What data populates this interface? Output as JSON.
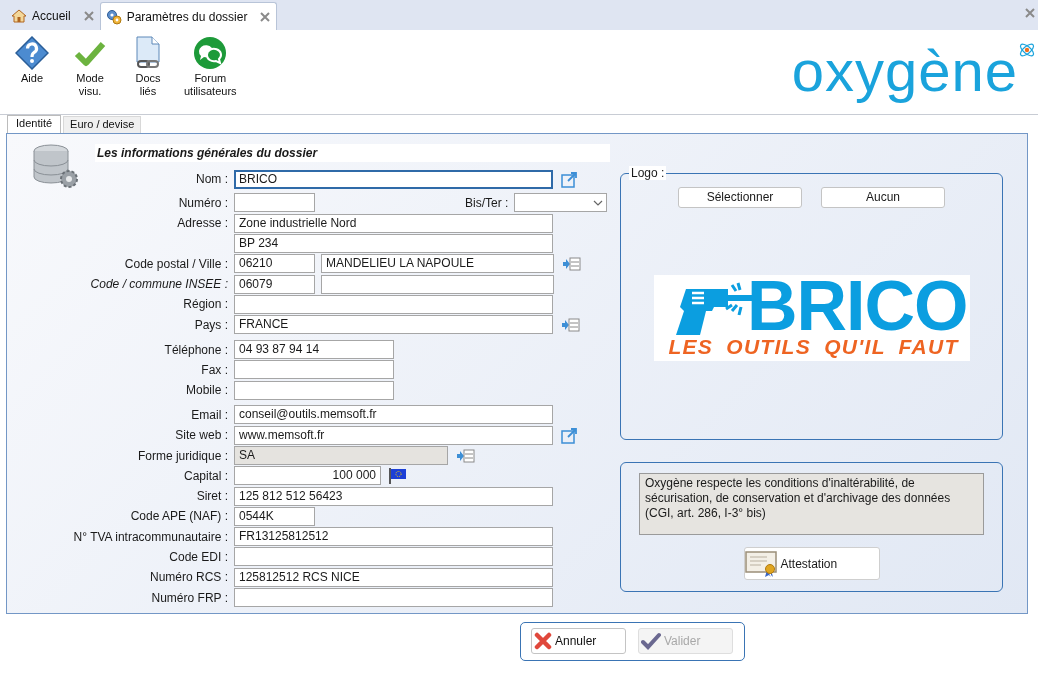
{
  "tabs": [
    {
      "label": "Accueil",
      "selected": false
    },
    {
      "label": "Paramètres du dossier",
      "selected": true
    }
  ],
  "toolbar": [
    {
      "lines": [
        "Aide"
      ]
    },
    {
      "lines": [
        "Mode",
        "visu."
      ]
    },
    {
      "lines": [
        "Docs",
        "liés"
      ]
    },
    {
      "lines": [
        "Forum",
        "utilisateurs"
      ]
    }
  ],
  "brand": {
    "name": "oxygène"
  },
  "subtabs": [
    {
      "label": "Identité",
      "selected": true
    },
    {
      "label": "Euro / devise",
      "selected": false
    }
  ],
  "section_title": "Les informations générales du dossier",
  "form_groups": [
    {
      "rows": [
        {
          "label": "Nom :",
          "italic": false,
          "kind": "link",
          "fields": [
            {
              "kind": "long",
              "value": "BRICO",
              "focused": true,
              "disabled": false
            }
          ]
        },
        {
          "label": "Numéro :",
          "italic": false,
          "fields": [
            {
              "kind": "short",
              "focused": false,
              "disabled": false
            },
            {
              "kind": "select",
              "label": "Bis/Ter :",
              "focused": false,
              "disabled": false
            }
          ]
        },
        {
          "label": "Adresse :",
          "italic": false,
          "fields": [
            {
              "kind": "long",
              "value": "Zone industrielle Nord",
              "focused": false,
              "disabled": false
            }
          ]
        },
        {
          "fields": [
            {
              "kind": "long",
              "value": "BP 234",
              "focused": false,
              "disabled": false
            }
          ]
        },
        {
          "label": "Code postal / Ville :",
          "italic": false,
          "kind": "list",
          "fields": [
            {
              "kind": "short",
              "value": "06210",
              "focused": false,
              "disabled": false
            },
            {
              "kind": "city",
              "value": "MANDELIEU LA NAPOULE",
              "focused": false,
              "disabled": false
            }
          ]
        },
        {
          "label": "Code / commune INSEE :",
          "italic": true,
          "fields": [
            {
              "kind": "short",
              "value": "06079",
              "focused": false,
              "disabled": false
            },
            {
              "kind": "city",
              "focused": false,
              "disabled": false
            }
          ]
        },
        {
          "label": "Région :",
          "italic": false,
          "fields": [
            {
              "kind": "long",
              "focused": false,
              "disabled": false
            }
          ]
        },
        {
          "label": "Pays :",
          "italic": false,
          "kind": "list",
          "fields": [
            {
              "kind": "long",
              "value": "FRANCE",
              "focused": false,
              "disabled": false
            }
          ]
        }
      ]
    },
    {
      "rows": [
        {
          "label": "Téléphone :",
          "italic": false,
          "fields": [
            {
              "kind": "medium",
              "value": "04 93 87 94 14",
              "focused": false,
              "disabled": false
            }
          ]
        },
        {
          "label": "Fax :",
          "italic": false,
          "fields": [
            {
              "kind": "medium",
              "focused": false,
              "disabled": false
            }
          ]
        },
        {
          "label": "Mobile :",
          "italic": false,
          "fields": [
            {
              "kind": "medium",
              "focused": false,
              "disabled": false
            }
          ]
        }
      ]
    },
    {
      "rows": [
        {
          "label": "Email :",
          "italic": false,
          "fields": [
            {
              "kind": "long",
              "value": "conseil@outils.memsoft.fr",
              "focused": false,
              "disabled": false
            }
          ]
        },
        {
          "label": "Site web :",
          "italic": false,
          "kind": "link",
          "fields": [
            {
              "kind": "long",
              "value": "www.memsoft.fr",
              "focused": false,
              "disabled": false
            }
          ]
        },
        {
          "label": "Forme juridique :",
          "italic": false,
          "kind": "list",
          "fields": [
            {
              "kind": "wide",
              "value": "SA",
              "focused": false,
              "disabled": true
            }
          ]
        },
        {
          "label": "Capital :",
          "italic": false,
          "kind": "flag",
          "fields": [
            {
              "kind": "amount",
              "value": "100 000",
              "focused": false,
              "disabled": false
            }
          ]
        },
        {
          "label": "Siret :",
          "italic": false,
          "fields": [
            {
              "kind": "long",
              "value": "125 812 512 56423",
              "focused": false,
              "disabled": false
            }
          ]
        },
        {
          "label": "Code APE (NAF) :",
          "italic": false,
          "fields": [
            {
              "kind": "short",
              "value": "0544K",
              "focused": false,
              "disabled": false
            }
          ]
        },
        {
          "label": "N° TVA intracommunautaire :",
          "italic": false,
          "fields": [
            {
              "kind": "long",
              "value": "FR13125812512",
              "focused": false,
              "disabled": false
            }
          ]
        },
        {
          "label": "Code EDI :",
          "italic": false,
          "fields": [
            {
              "kind": "long",
              "focused": false,
              "disabled": false
            }
          ]
        },
        {
          "label": "Numéro RCS :",
          "italic": false,
          "fields": [
            {
              "kind": "long",
              "value": "125812512 RCS NICE",
              "focused": false,
              "disabled": false
            }
          ]
        },
        {
          "label": "Numéro FRP :",
          "italic": false,
          "fields": [
            {
              "kind": "long",
              "focused": false,
              "disabled": false
            }
          ]
        }
      ]
    }
  ],
  "logo": {
    "legend": "Logo :",
    "buttons": [
      "Sélectionner",
      "Aucun"
    ],
    "image": {
      "wordmark": "BRICO",
      "slogan": "LES OUTILS QU'IL FAUT"
    }
  },
  "compliance": {
    "text": "Oxygène respecte les conditions d'inaltérabilité, de sécurisation, de conservation et d'archivage des données (CGI, art. 286, I-3° bis)",
    "button": "Attestation"
  },
  "footer_buttons": [
    {
      "label": "Annuler",
      "kind": "cancel",
      "disabled": false
    },
    {
      "label": "Valider",
      "kind": "confirm",
      "disabled": true
    }
  ]
}
